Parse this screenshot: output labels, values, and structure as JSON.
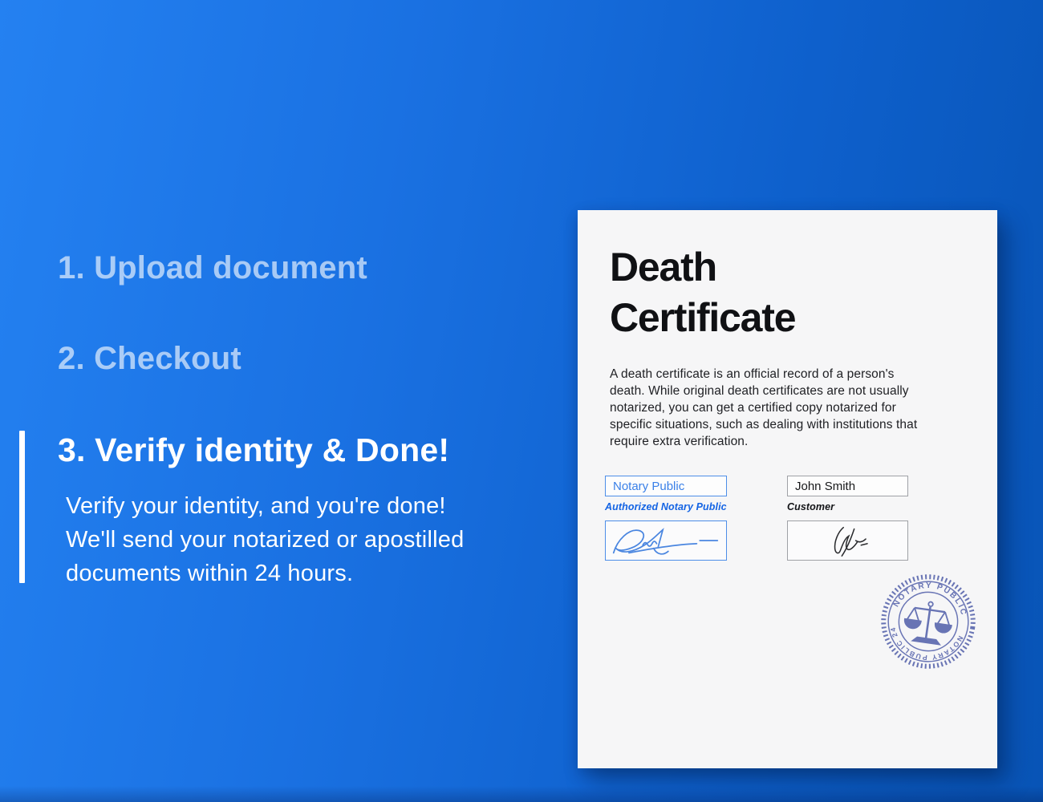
{
  "colors": {
    "bg_gradient_left": "#2481f1",
    "bg_gradient_right": "#0854b6",
    "step_inactive_text": "rgba(255,255,255,0.62)",
    "step_active_text": "#ffffff",
    "paper": "#f6f6f7",
    "doc_text": "#101114",
    "accent_blue": "#3a80e8",
    "label_blue": "#1464e4",
    "stamp_blue": "#5d69af"
  },
  "steps": [
    {
      "text": "1. Upload document",
      "active": false
    },
    {
      "text": "2. Checkout",
      "active": false
    },
    {
      "text": "3. Verify identity & Done!",
      "active": true
    }
  ],
  "active_step_description": "Verify your identity, and you're done!\nWe'll send your notarized or apostilled\ndocuments within 24 hours.",
  "document": {
    "title": "Death\nCertificate",
    "body": "A death certificate is an official record of a person's\ndeath. While original death certificates are not usually\nnotarized, you can get a certified copy notarized for\nspecific situations, such as dealing with institutions that\nrequire extra verification.",
    "notary_field": {
      "value": "Notary Public",
      "label": "Authorized Notary Public"
    },
    "customer_field": {
      "value": "John Smith",
      "label": "Customer"
    },
    "stamp": {
      "arc_top": "NOTARY PUBLIC",
      "arc_bottom": "NOTARY PUBLIC 24"
    }
  }
}
